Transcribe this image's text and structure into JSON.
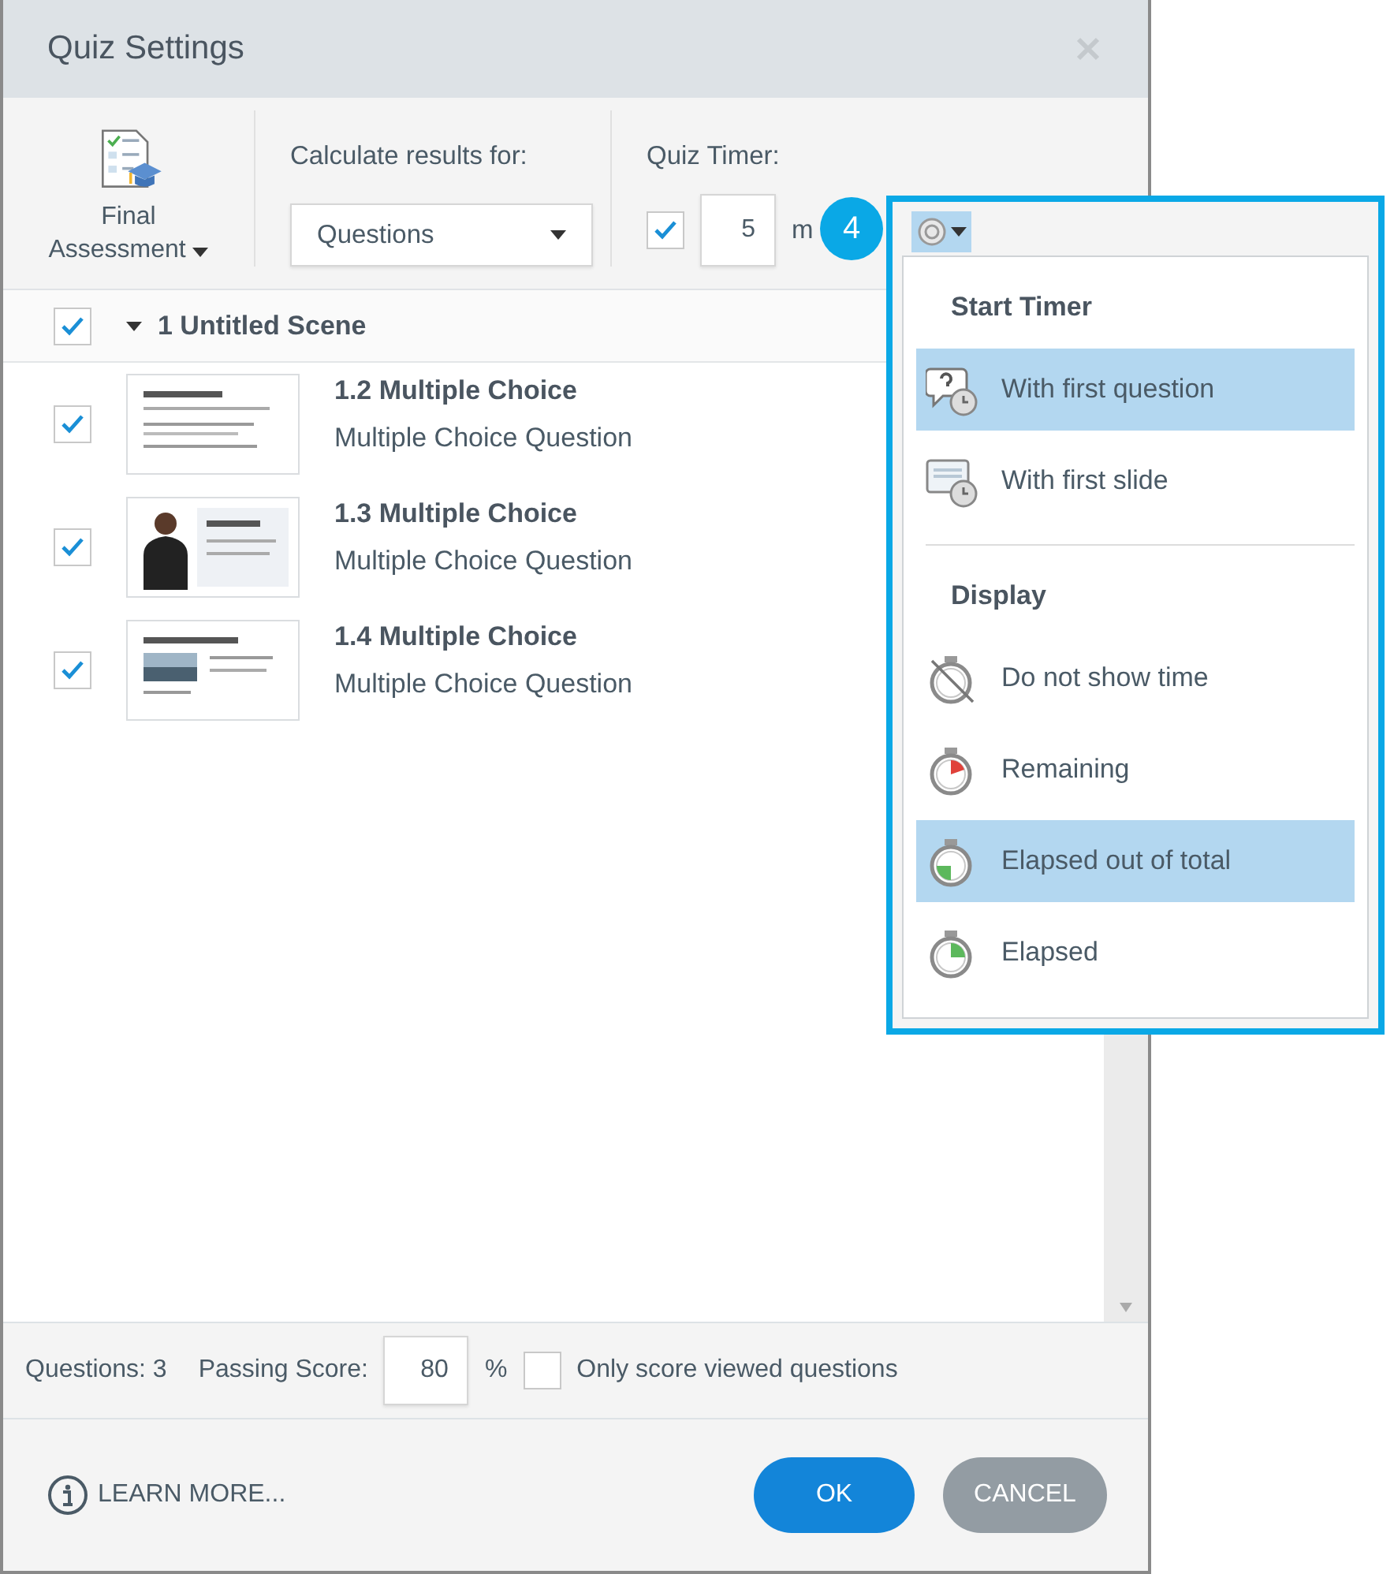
{
  "window": {
    "title": "Quiz Settings"
  },
  "toolbar": {
    "assessment": {
      "label": "Final Assessment"
    },
    "calculate": {
      "label": "Calculate results for:",
      "value": "Questions"
    },
    "timer": {
      "label": "Quiz Timer:",
      "enabled": true,
      "value": "5",
      "unit": "m"
    }
  },
  "scene": {
    "checked": true,
    "expanded": true,
    "title": "1 Untitled Scene"
  },
  "slides": [
    {
      "checked": true,
      "title": "1.2 Multiple Choice",
      "subtitle": "Multiple Choice Question"
    },
    {
      "checked": true,
      "title": "1.3 Multiple Choice",
      "subtitle": "Multiple Choice Question"
    },
    {
      "checked": true,
      "title": "1.4 Multiple Choice",
      "subtitle": "Multiple Choice Question"
    }
  ],
  "footer": {
    "questions": "Questions: 3",
    "passing_label": "Passing Score:",
    "passing_value": "80",
    "percent": "%",
    "only_viewed": {
      "label": "Only score viewed questions",
      "checked": false
    }
  },
  "learn_more": "LEARN MORE...",
  "buttons": [
    {
      "label": "OK",
      "kind": "primary"
    },
    {
      "label": "CANCEL",
      "kind": "secondary"
    }
  ],
  "callout": {
    "badge": "4"
  },
  "timer_menu": {
    "sections": [
      {
        "title": "Start Timer",
        "items": [
          {
            "label": "With first question",
            "kind": "question",
            "selected": true
          },
          {
            "label": "With first slide",
            "kind": "slide",
            "selected": false
          }
        ]
      },
      {
        "title": "Display",
        "items": [
          {
            "label": "Do not show time",
            "kind": "hidden",
            "selected": false
          },
          {
            "label": "Remaining",
            "kind": "remaining",
            "selected": false
          },
          {
            "label": "Elapsed out of total",
            "kind": "elapsed_total",
            "selected": true
          },
          {
            "label": "Elapsed",
            "kind": "elapsed",
            "selected": false
          }
        ]
      }
    ]
  }
}
